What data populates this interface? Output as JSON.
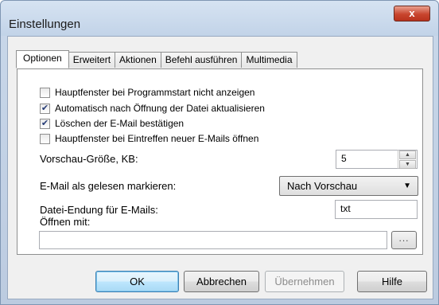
{
  "window": {
    "title": "Einstellungen",
    "close_glyph": "x"
  },
  "tabs": [
    {
      "label": "Optionen",
      "active": true
    },
    {
      "label": "Erweitert",
      "active": false
    },
    {
      "label": "Aktionen",
      "active": false
    },
    {
      "label": "Befehl ausführen",
      "active": false
    },
    {
      "label": "Multimedia",
      "active": false
    }
  ],
  "options": {
    "checkboxes": [
      {
        "label": "Hauptfenster bei Programmstart nicht anzeigen",
        "checked": false
      },
      {
        "label": "Automatisch nach Öffnung der Datei aktualisieren",
        "checked": true
      },
      {
        "label": "Löschen der E-Mail bestätigen",
        "checked": true
      },
      {
        "label": "Hauptfenster bei Eintreffen neuer E-Mails öffnen",
        "checked": false
      }
    ],
    "preview_size_label": "Vorschau-Größe, KB:",
    "preview_size_value": "5",
    "mark_read_label": "E-Mail als gelesen markieren:",
    "mark_read_value": "Nach Vorschau",
    "extension_label": "Datei-Endung für E-Mails:",
    "extension_value": "txt",
    "open_with_label": "Öffnen mit:",
    "open_with_value": "",
    "browse_label": "..."
  },
  "buttons": {
    "ok": "OK",
    "cancel": "Abbrechen",
    "apply": "Übernehmen",
    "help": "Hilfe"
  },
  "colors": {
    "accent": "#3c7fb1",
    "close": "#c8452e"
  }
}
